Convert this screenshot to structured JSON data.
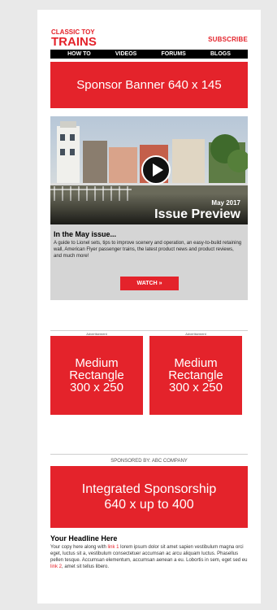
{
  "header": {
    "logo_line1": "CLASSIC TOY",
    "logo_line2": "TRAINS",
    "subscribe_label": "SUBSCRIBE"
  },
  "nav": {
    "items": [
      "HOW TO",
      "VIDEOS",
      "FORUMS",
      "BLOGS"
    ]
  },
  "sponsor_banner": {
    "label": "Sponsor Banner 640 x 145"
  },
  "issue_preview": {
    "date": "May 2017",
    "title": "Issue Preview",
    "heading": "In the May issue...",
    "body": "A guide to Lionel sets, tips to improve scenery and operation, an easy-to-build retaining wall, American Flyer passenger trains, the latest product news and product reviews, and much more!",
    "watch_label": "WATCH »"
  },
  "ads": {
    "label": "Advertisement",
    "rect1": [
      "Medium",
      "Rectangle",
      "300 x 250"
    ],
    "rect2": [
      "Medium",
      "Rectangle",
      "300 x 250"
    ]
  },
  "sponsored": {
    "label": "SPONSORED BY: ABC COMPANY",
    "line1": "Integrated Sponsorship",
    "line2": "640 x up to 400"
  },
  "article": {
    "headline": "Your Headline Here",
    "part1": "Your copy here along with ",
    "link1": "link 1",
    "part2": " lorem ipsum dolor sit amet sapien vestibulum magna orci eget, luctus sit a, vestibulum consectetuer accumsan ac arcu aliquam luctus. Phasellus pellen tesque. Accumsan elementum, accumsan aenean a eu. Lobortis in sem, eget sed eu ",
    "link2": "link 2",
    "part3": ", amet sit tellus libero."
  },
  "colors": {
    "brand_red": "#e4232b",
    "nav_black": "#000000"
  }
}
